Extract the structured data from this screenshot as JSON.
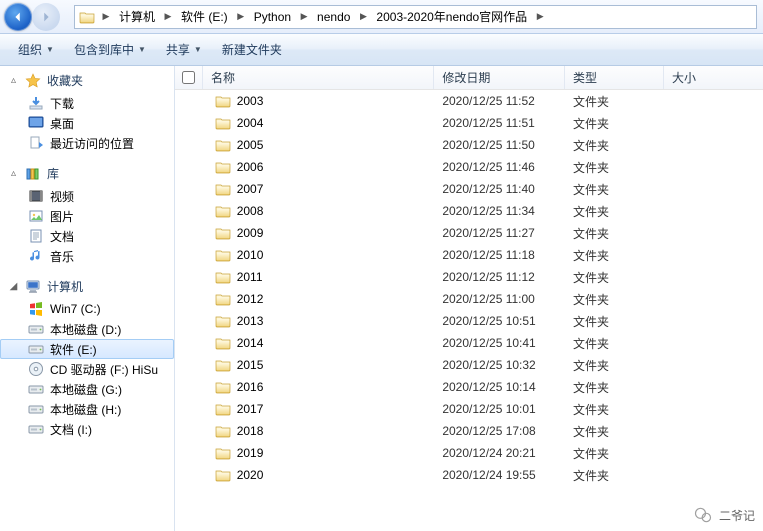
{
  "nav": {
    "crumbs": [
      "计算机",
      "软件 (E:)",
      "Python",
      "nendo",
      "2003-2020年nendo官网作品"
    ]
  },
  "toolbar": {
    "organize": "组织",
    "include": "包含到库中",
    "share": "共享",
    "newfolder": "新建文件夹"
  },
  "sidebar": {
    "fav": {
      "label": "收藏夹",
      "items": [
        "下载",
        "桌面",
        "最近访问的位置"
      ]
    },
    "lib": {
      "label": "库",
      "items": [
        "视频",
        "图片",
        "文档",
        "音乐"
      ]
    },
    "comp": {
      "label": "计算机",
      "items": [
        "Win7 (C:)",
        "本地磁盘 (D:)",
        "软件 (E:)",
        "CD 驱动器 (F:) HiSu",
        "本地磁盘 (G:)",
        "本地磁盘 (H:)",
        "文档 (I:)"
      ],
      "selected": 2
    }
  },
  "columns": {
    "name": "名称",
    "date": "修改日期",
    "type": "类型",
    "size": "大小"
  },
  "type_folder": "文件夹",
  "files": [
    {
      "name": "2003",
      "date": "2020/12/25 11:52"
    },
    {
      "name": "2004",
      "date": "2020/12/25 11:51"
    },
    {
      "name": "2005",
      "date": "2020/12/25 11:50"
    },
    {
      "name": "2006",
      "date": "2020/12/25 11:46"
    },
    {
      "name": "2007",
      "date": "2020/12/25 11:40"
    },
    {
      "name": "2008",
      "date": "2020/12/25 11:34"
    },
    {
      "name": "2009",
      "date": "2020/12/25 11:27"
    },
    {
      "name": "2010",
      "date": "2020/12/25 11:18"
    },
    {
      "name": "2011",
      "date": "2020/12/25 11:12"
    },
    {
      "name": "2012",
      "date": "2020/12/25 11:00"
    },
    {
      "name": "2013",
      "date": "2020/12/25 10:51"
    },
    {
      "name": "2014",
      "date": "2020/12/25 10:41"
    },
    {
      "name": "2015",
      "date": "2020/12/25 10:32"
    },
    {
      "name": "2016",
      "date": "2020/12/25 10:14"
    },
    {
      "name": "2017",
      "date": "2020/12/25 10:01"
    },
    {
      "name": "2018",
      "date": "2020/12/25 17:08"
    },
    {
      "name": "2019",
      "date": "2020/12/24 20:21"
    },
    {
      "name": "2020",
      "date": "2020/12/24 19:55"
    }
  ],
  "watermark": "二爷记"
}
